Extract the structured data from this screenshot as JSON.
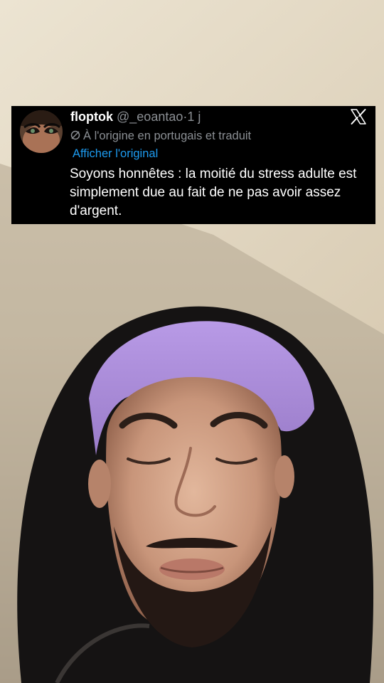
{
  "tweet": {
    "display_name": "floptok",
    "handle": "@_eoantao",
    "separator": "·",
    "age": "1 j",
    "translation_note": "À l'origine en portugais et traduit",
    "show_original": "Afficher l'original",
    "text": "Soyons honnêtes : la moitié du stress adulte est simplement due au fait de ne pas avoir assez d'argent.",
    "platform_icon": "x-logo-icon",
    "translate_icon": "translate-icon"
  },
  "colors": {
    "card_bg": "#000000",
    "text_primary": "#ffffff",
    "text_secondary": "#8b8f94",
    "link_blue": "#1d9bf0",
    "cap_purple": "#a88ad8"
  }
}
